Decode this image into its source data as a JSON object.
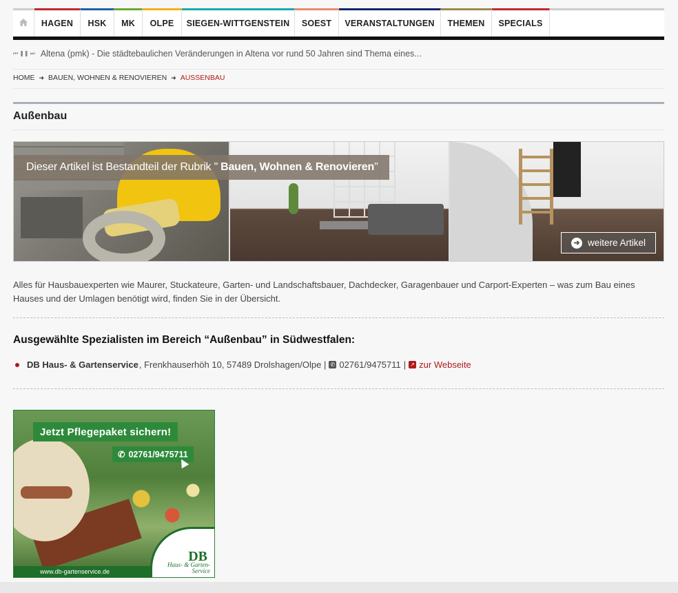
{
  "nav": {
    "home_icon": "home-icon",
    "items": [
      {
        "label": "HAGEN",
        "color": "#c0272d",
        "width": 67
      },
      {
        "label": "HSK",
        "color": "#1f5fa8",
        "width": 49
      },
      {
        "label": "MK",
        "color": "#6aa82f",
        "width": 41
      },
      {
        "label": "OLPE",
        "color": "#f0b21a",
        "width": 57
      },
      {
        "label": "SIEGEN-WITTGENSTEIN",
        "color": "#1aa8a8",
        "width": 164
      },
      {
        "label": "SOEST",
        "color": "#e98a6a",
        "width": 64
      },
      {
        "label": "VERANSTALTUNGEN",
        "color": "#13266b",
        "width": 148
      },
      {
        "label": "THEMEN",
        "color": "#9a8a4a",
        "width": 74
      },
      {
        "label": "SPECIALS",
        "color": "#c0272d",
        "width": 84
      }
    ]
  },
  "ticker": {
    "text": "Altena (pmk) - Die städtebaulichen Veränderungen in Altena vor rund 50 Jahren sind Thema eines..."
  },
  "breadcrumb": {
    "home": "HOME",
    "level1": "BAUEN, WOHNEN & RENOVIEREN",
    "current": "AUSSENBAU"
  },
  "page": {
    "title": "Außenbau"
  },
  "banner": {
    "label_prefix": "Dieser Artikel ist Bestandteil der Rubrik \"",
    "label_bold": "Bauen, Wohnen & Renovieren",
    "label_suffix": "\"",
    "more_button": "weitere Artikel"
  },
  "intro": {
    "text": "Alles für Hausbauexperten wie Maurer, Stuckateure, Garten- und Landschaftsbauer, Dachdecker, Garagenbauer und Carport-Experten – was zum Bau eines Hauses und der Umlagen benötigt wird, finden Sie in der Übersicht."
  },
  "specialists": {
    "title": "Ausgewählte Spezialisten im Bereich “Außenbau” in Südwestfalen:",
    "items": [
      {
        "name": "DB Haus- & Gartenservice",
        "address": ", Frenkhauserhöh 10, 57489 Drolshagen/Olpe |",
        "phone": "02761/9475711",
        "separator": "|",
        "link": "zur Webseite"
      }
    ]
  },
  "ad": {
    "headline": "Jetzt Pflegepaket sichern!",
    "phone": "02761/9475711",
    "url": "www.db-gartenservice.de",
    "logo": "DB",
    "logo_sub": "Haus- & Garten- Service"
  }
}
